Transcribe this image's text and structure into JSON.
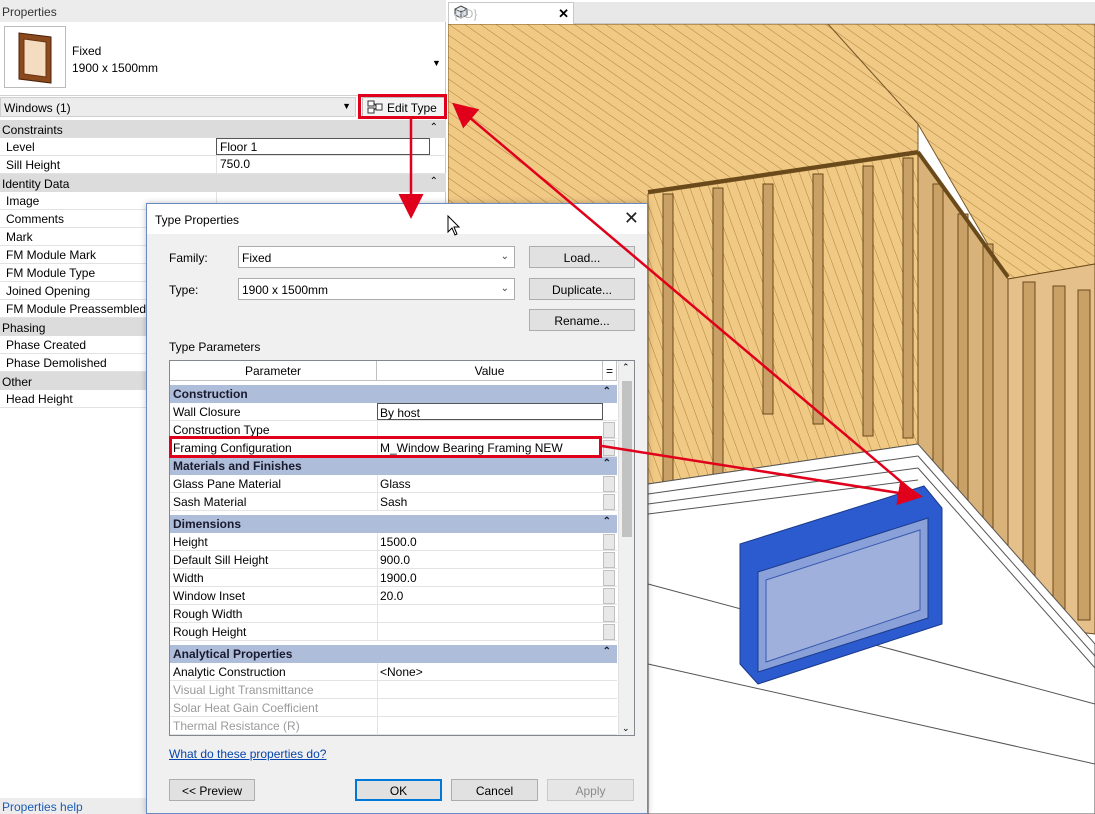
{
  "properties": {
    "title": "Properties",
    "family": "Fixed",
    "type": "1900 x 1500mm",
    "instance_selector": "Windows (1)",
    "edit_type_label": "Edit Type",
    "help_link": "Properties help",
    "groups": [
      {
        "name": "Constraints",
        "rows": [
          {
            "label": "Level",
            "value": "Floor 1"
          },
          {
            "label": "Sill Height",
            "value": "750.0"
          }
        ]
      },
      {
        "name": "Identity Data",
        "rows": [
          {
            "label": "Image",
            "value": ""
          },
          {
            "label": "Comments",
            "value": ""
          },
          {
            "label": "Mark",
            "value": ""
          },
          {
            "label": "FM Module Mark",
            "value": ""
          },
          {
            "label": "FM Module Type",
            "value": ""
          },
          {
            "label": "Joined Opening",
            "value": ""
          },
          {
            "label": "FM Module Preassembled",
            "value": ""
          }
        ]
      },
      {
        "name": "Phasing",
        "rows": [
          {
            "label": "Phase Created",
            "value": ""
          },
          {
            "label": "Phase Demolished",
            "value": ""
          }
        ]
      },
      {
        "name": "Other",
        "rows": [
          {
            "label": "Head Height",
            "value": ""
          }
        ]
      }
    ]
  },
  "view_tab": {
    "label": "{3D}"
  },
  "dialog": {
    "title": "Type Properties",
    "family_label": "Family:",
    "family_value": "Fixed",
    "type_label": "Type:",
    "type_value": "1900 x 1500mm",
    "load_button": "Load...",
    "duplicate_button": "Duplicate...",
    "rename_button": "Rename...",
    "type_parameters_label": "Type Parameters",
    "col_parameter": "Parameter",
    "col_value": "Value",
    "col_eq": "=",
    "sections": [
      {
        "name": "Construction",
        "rows": [
          {
            "label": "Wall Closure",
            "value": "By host"
          },
          {
            "label": "Construction Type",
            "value": ""
          },
          {
            "label": "Framing Configuration",
            "value": "M_Window Bearing Framing NEW"
          }
        ]
      },
      {
        "name": "Materials and Finishes",
        "rows": [
          {
            "label": "Glass Pane Material",
            "value": "Glass"
          },
          {
            "label": "Sash Material",
            "value": "Sash"
          }
        ]
      },
      {
        "name": "Dimensions",
        "rows": [
          {
            "label": "Height",
            "value": "1500.0"
          },
          {
            "label": "Default Sill Height",
            "value": "900.0"
          },
          {
            "label": "Width",
            "value": "1900.0"
          },
          {
            "label": "Window Inset",
            "value": "20.0"
          },
          {
            "label": "Rough Width",
            "value": ""
          },
          {
            "label": "Rough Height",
            "value": ""
          }
        ]
      },
      {
        "name": "Analytical Properties",
        "rows": [
          {
            "label": "Analytic Construction",
            "value": "<None>"
          },
          {
            "label": "Visual Light Transmittance",
            "value": ""
          },
          {
            "label": "Solar Heat Gain Coefficient",
            "value": ""
          },
          {
            "label": "Thermal Resistance (R)",
            "value": ""
          }
        ]
      }
    ],
    "help_link": "What do these properties do?",
    "preview_button": "<< Preview",
    "ok_button": "OK",
    "cancel_button": "Cancel",
    "apply_button": "Apply"
  },
  "colors": {
    "highlight": "#e0001b",
    "section_header": "#aebdd9",
    "window_blue": "#3b6fd6",
    "wood": "#e8b868"
  }
}
